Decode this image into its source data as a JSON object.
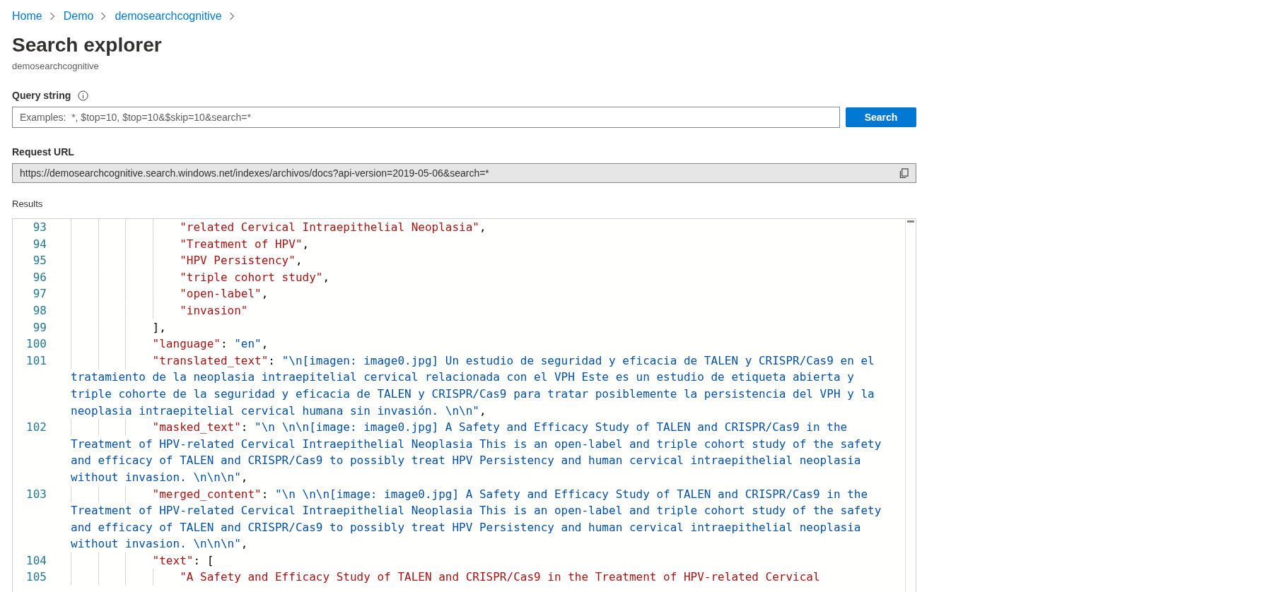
{
  "breadcrumb": [
    {
      "label": "Home"
    },
    {
      "label": "Demo"
    },
    {
      "label": "demosearchcognitive"
    }
  ],
  "title": "Search explorer",
  "subtitle": "demosearchcognitive",
  "query": {
    "label": "Query string",
    "placeholder": "Examples:  *, $top=10, $top=10&$skip=10&search=*",
    "button": "Search"
  },
  "request_url": {
    "label": "Request URL",
    "value": "https://demosearchcognitive.search.windows.net/indexes/archivos/docs?api-version=2019-05-06&search=*"
  },
  "results": {
    "label": "Results",
    "lines": [
      {
        "number": "93",
        "kind": "array-item",
        "tokens": [
          {
            "kind": "item",
            "text": "\"related Cervical Intraepithelial Neoplasia\""
          },
          {
            "kind": "punct",
            "text": ","
          }
        ]
      },
      {
        "number": "94",
        "kind": "array-item",
        "tokens": [
          {
            "kind": "item",
            "text": "\"Treatment of HPV\""
          },
          {
            "kind": "punct",
            "text": ","
          }
        ]
      },
      {
        "number": "95",
        "kind": "array-item",
        "tokens": [
          {
            "kind": "item",
            "text": "\"HPV Persistency\""
          },
          {
            "kind": "punct",
            "text": ","
          }
        ]
      },
      {
        "number": "96",
        "kind": "array-item",
        "tokens": [
          {
            "kind": "item",
            "text": "\"triple cohort study\""
          },
          {
            "kind": "punct",
            "text": ","
          }
        ]
      },
      {
        "number": "97",
        "kind": "array-item",
        "tokens": [
          {
            "kind": "item",
            "text": "\"open-label\""
          },
          {
            "kind": "punct",
            "text": ","
          }
        ]
      },
      {
        "number": "98",
        "kind": "array-item",
        "tokens": [
          {
            "kind": "item",
            "text": "\"invasion\""
          }
        ]
      },
      {
        "number": "99",
        "kind": "property",
        "tokens": [
          {
            "kind": "punct",
            "text": "],"
          }
        ]
      },
      {
        "number": "100",
        "kind": "property",
        "tokens": [
          {
            "kind": "key",
            "text": "\"language\""
          },
          {
            "kind": "punct",
            "text": ": "
          },
          {
            "kind": "value",
            "text": "\"en\""
          },
          {
            "kind": "punct",
            "text": ","
          }
        ]
      },
      {
        "number": "101",
        "kind": "property",
        "tokens": [
          {
            "kind": "key",
            "text": "\"translated_text\""
          },
          {
            "kind": "punct",
            "text": ": "
          },
          {
            "kind": "value",
            "text": "\"\\n[imagen: image0.jpg] Un estudio de seguridad y eficacia de TALEN y CRISPR/Cas9 en el tratamiento de la neoplasia intraepitelial cervical relacionada con el VPH Este es un estudio de etiqueta abierta y triple cohorte de la seguridad y eficacia de TALEN y CRISPR/Cas9 para tratar posiblemente la persistencia del VPH y la neoplasia intraepitelial cervical humana sin invasión. \\n\\n\""
          },
          {
            "kind": "punct",
            "text": ","
          }
        ]
      },
      {
        "number": "102",
        "kind": "property",
        "tokens": [
          {
            "kind": "key",
            "text": "\"masked_text\""
          },
          {
            "kind": "punct",
            "text": ": "
          },
          {
            "kind": "value",
            "text": "\"\\n \\n\\n[image: image0.jpg] A Safety and Efficacy Study of TALEN and CRISPR/Cas9 in the Treatment of HPV-related Cervical Intraepithelial Neoplasia This is an open-label and triple cohort study of the safety and efficacy of TALEN and CRISPR/Cas9 to possibly treat HPV Persistency and human cervical intraepithelial neoplasia without invasion. \\n\\n\\n\""
          },
          {
            "kind": "punct",
            "text": ","
          }
        ]
      },
      {
        "number": "103",
        "kind": "property",
        "tokens": [
          {
            "kind": "key",
            "text": "\"merged_content\""
          },
          {
            "kind": "punct",
            "text": ": "
          },
          {
            "kind": "value",
            "text": "\"\\n \\n\\n[image: image0.jpg] A Safety and Efficacy Study of TALEN and CRISPR/Cas9 in the Treatment of HPV-related Cervical Intraepithelial Neoplasia This is an open-label and triple cohort study of the safety and efficacy of TALEN and CRISPR/Cas9 to possibly treat HPV Persistency and human cervical intraepithelial neoplasia without invasion. \\n\\n\\n\""
          },
          {
            "kind": "punct",
            "text": ","
          }
        ]
      },
      {
        "number": "104",
        "kind": "property",
        "tokens": [
          {
            "kind": "key",
            "text": "\"text\""
          },
          {
            "kind": "punct",
            "text": ": ["
          }
        ]
      },
      {
        "number": "105",
        "kind": "array-item",
        "tokens": [
          {
            "kind": "item",
            "text": "\"A Safety and Efficacy Study of TALEN and CRISPR/Cas9 in the Treatment of HPV-related Cervical"
          }
        ]
      }
    ]
  }
}
